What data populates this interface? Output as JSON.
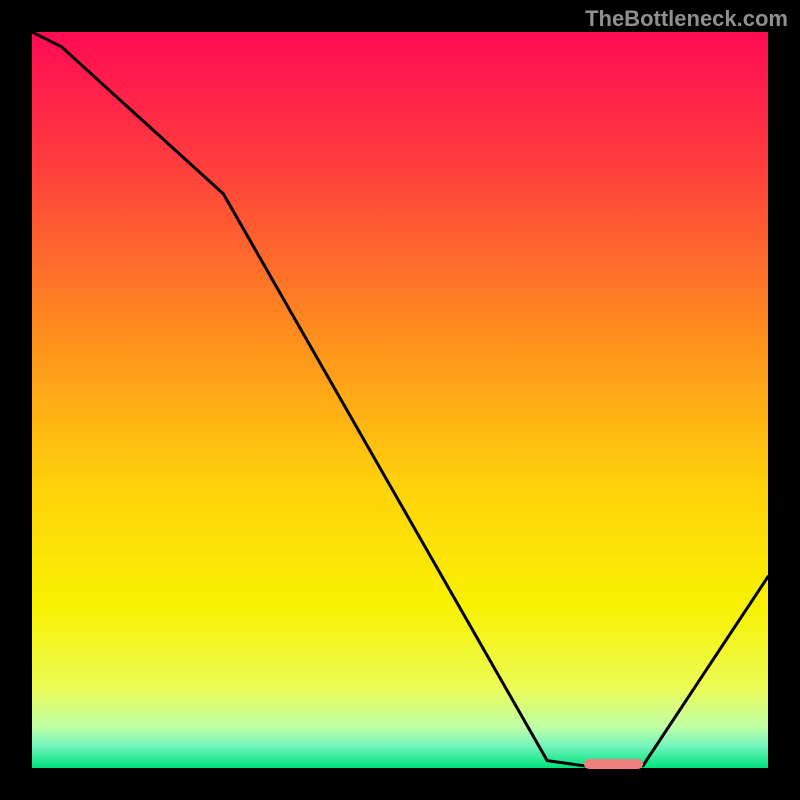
{
  "watermark": "TheBottleneck.com",
  "colors": {
    "frame": "#000000",
    "line": "#000000",
    "marker": "#f08080",
    "gradient_stops": [
      {
        "offset": 0.0,
        "color": "#ff0b54"
      },
      {
        "offset": 0.18,
        "color": "#ff3d3d"
      },
      {
        "offset": 0.4,
        "color": "#ff8a1f"
      },
      {
        "offset": 0.62,
        "color": "#ffd30a"
      },
      {
        "offset": 0.78,
        "color": "#f8f200"
      },
      {
        "offset": 0.89,
        "color": "#ecfb55"
      },
      {
        "offset": 0.945,
        "color": "#bfffa6"
      },
      {
        "offset": 0.97,
        "color": "#73f5bd"
      },
      {
        "offset": 1.0,
        "color": "#00e27b"
      }
    ]
  },
  "chart_data": {
    "type": "line",
    "title": "",
    "xlabel": "",
    "ylabel": "",
    "xlim": [
      0,
      100
    ],
    "ylim": [
      0,
      100
    ],
    "x": [
      0,
      4,
      26,
      70,
      75,
      83,
      100
    ],
    "y": [
      100,
      98,
      78,
      1.0,
      0.3,
      0.3,
      26
    ],
    "marker_segment": {
      "x_start": 75,
      "x_end": 83,
      "y": 0.5
    },
    "notes": "y is plotted inverted (high values at top). Gradient background runs top (red) to bottom (green)."
  }
}
